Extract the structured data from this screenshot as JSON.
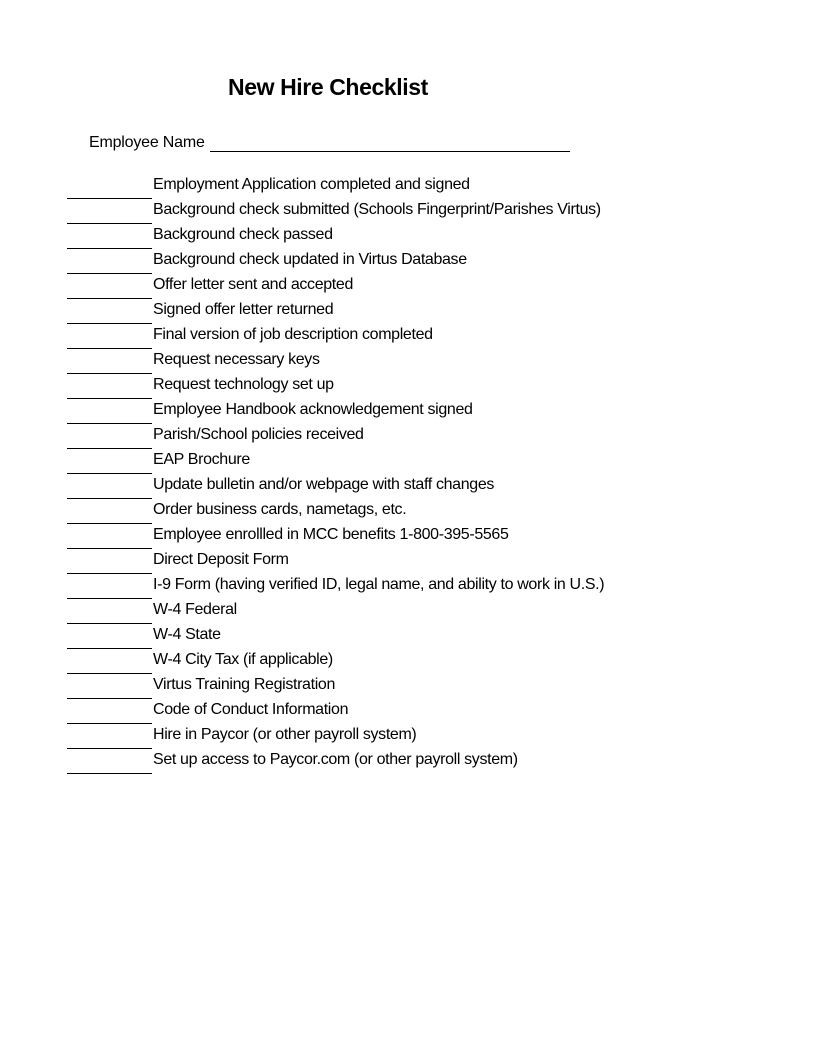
{
  "document": {
    "title": "New Hire Checklist",
    "employee_name_label": "Employee Name",
    "employee_name_value": "",
    "checklist": [
      "Employment Application completed and signed",
      "Background check submitted (Schools Fingerprint/Parishes Virtus)",
      "Background check passed",
      "Background check updated in Virtus Database",
      "Offer letter sent and accepted",
      "Signed offer letter returned",
      "Final version of job description completed",
      "Request necessary keys",
      "Request technology set up",
      "Employee Handbook acknowledgement signed",
      "Parish/School policies received",
      "EAP Brochure",
      "Update bulletin and/or webpage with staff changes",
      "Order business cards, nametags, etc.",
      "Employee enrollled in MCC benefits 1-800-395-5565",
      "Direct Deposit Form",
      "I-9 Form (having verified ID, legal name, and ability to work in U.S.)",
      "W-4 Federal",
      "W-4 State",
      "W-4 City Tax (if applicable)",
      "Virtus Training Registration",
      "Code of Conduct Information",
      "Hire in Paycor (or other payroll system)",
      "Set up access to Paycor.com (or other payroll system)"
    ]
  }
}
